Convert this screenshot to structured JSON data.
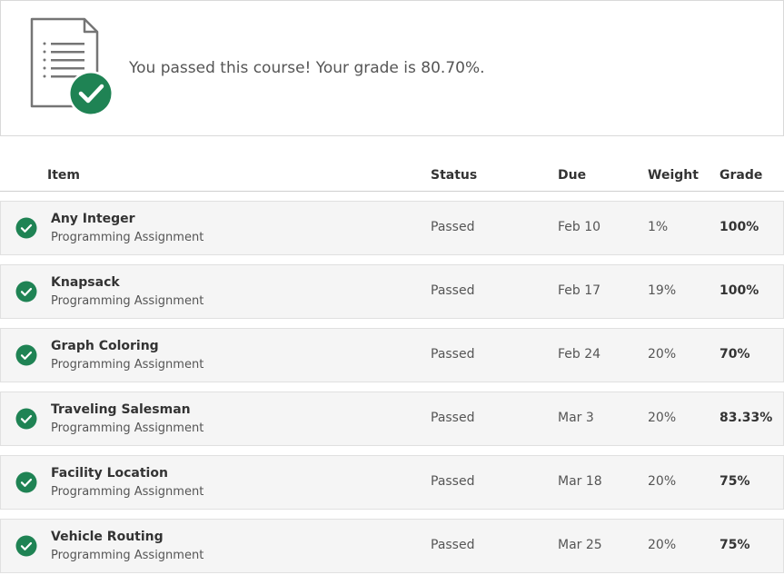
{
  "banner": {
    "message": "You passed this course! Your grade is 80.70%.",
    "icon": "document-checkmark-icon",
    "accent_color": "#1f8354"
  },
  "table": {
    "headers": {
      "item": "Item",
      "status": "Status",
      "due": "Due",
      "weight": "Weight",
      "grade": "Grade"
    },
    "rows": [
      {
        "title": "Any Integer",
        "type": "Programming Assignment",
        "status": "Passed",
        "due": "Feb 10",
        "weight": "1%",
        "grade": "100%"
      },
      {
        "title": "Knapsack",
        "type": "Programming Assignment",
        "status": "Passed",
        "due": "Feb 17",
        "weight": "19%",
        "grade": "100%"
      },
      {
        "title": "Graph Coloring",
        "type": "Programming Assignment",
        "status": "Passed",
        "due": "Feb 24",
        "weight": "20%",
        "grade": "70%"
      },
      {
        "title": "Traveling Salesman",
        "type": "Programming Assignment",
        "status": "Passed",
        "due": "Mar 3",
        "weight": "20%",
        "grade": "83.33%"
      },
      {
        "title": "Facility Location",
        "type": "Programming Assignment",
        "status": "Passed",
        "due": "Mar 18",
        "weight": "20%",
        "grade": "75%"
      },
      {
        "title": "Vehicle Routing",
        "type": "Programming Assignment",
        "status": "Passed",
        "due": "Mar 25",
        "weight": "20%",
        "grade": "75%"
      }
    ]
  }
}
